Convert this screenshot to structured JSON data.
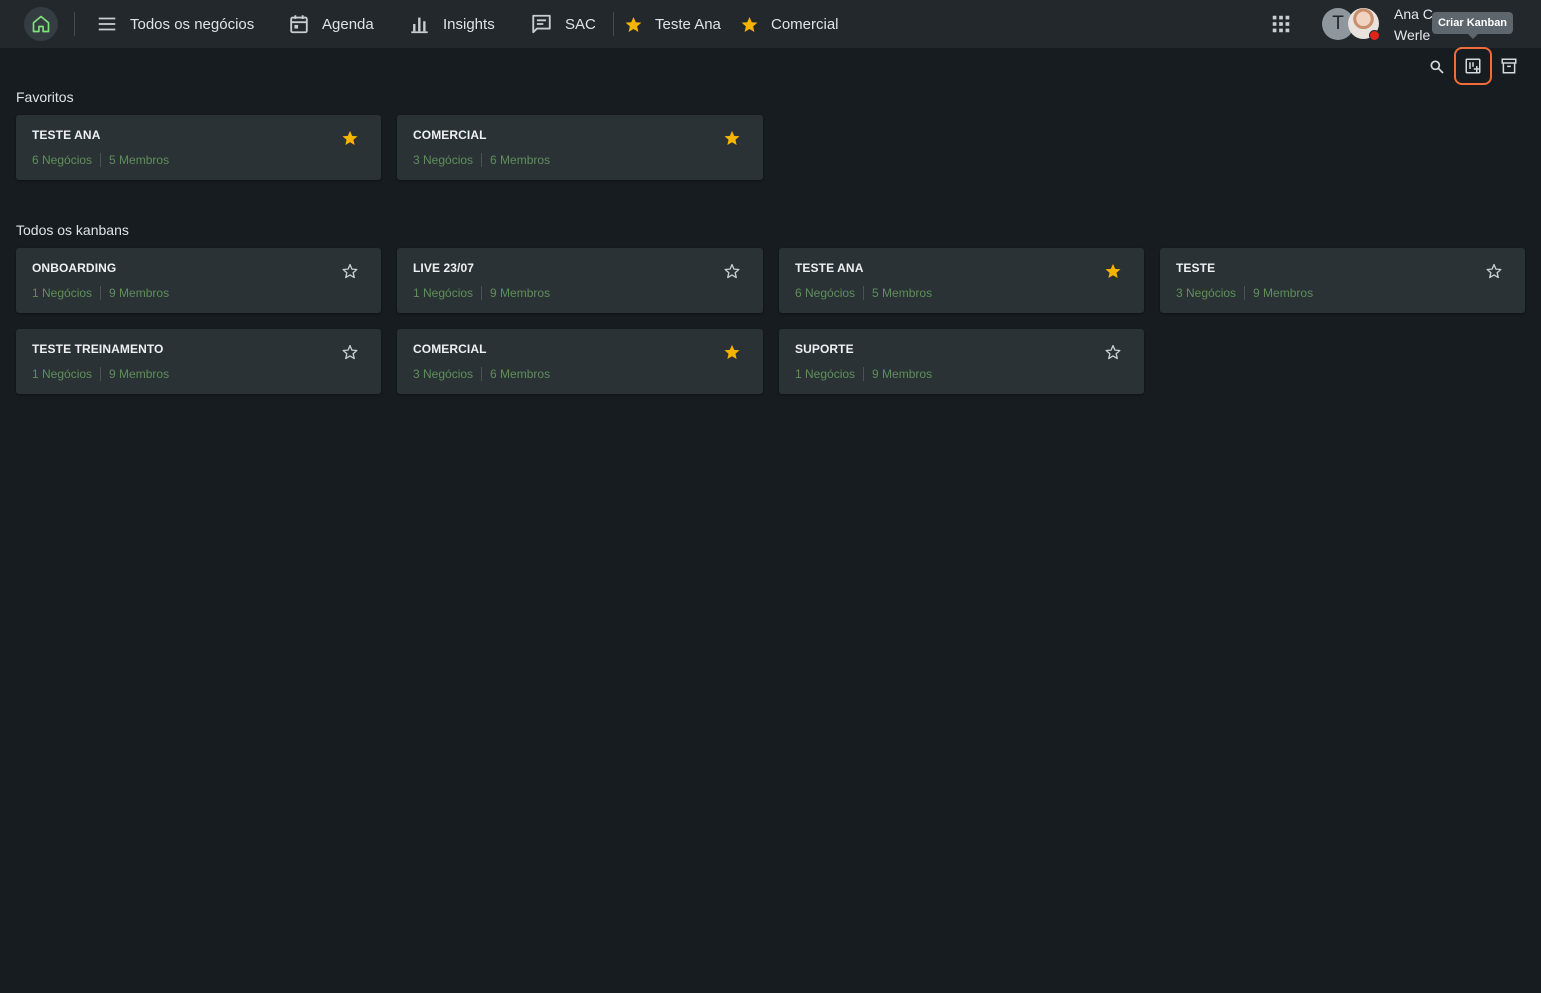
{
  "colors": {
    "accent": "#f26b3a",
    "star": "#f5b400",
    "meta_text": "#5e8f5a",
    "home_icon": "#7ee27a"
  },
  "nav": {
    "home_icon": "home-icon",
    "items": [
      {
        "label": "Todos os negócios",
        "icon": "menu-icon"
      },
      {
        "label": "Agenda",
        "icon": "calendar-icon"
      },
      {
        "label": "Insights",
        "icon": "bar-chart-icon"
      },
      {
        "label": "SAC",
        "icon": "chat-icon"
      },
      {
        "label": "Teste Ana",
        "icon": "star-icon"
      },
      {
        "label": "Comercial",
        "icon": "star-icon"
      }
    ]
  },
  "user": {
    "avatar_initial": "T",
    "name_line1": "Ana C",
    "name_line2": "Werle"
  },
  "tooltip": {
    "text": "Criar Kanban"
  },
  "sections": {
    "favorites_title": "Favoritos",
    "all_title": "Todos os kanbans"
  },
  "favorites": [
    {
      "title": "TESTE ANA",
      "deals": "6 Negócios",
      "members": "5 Membros",
      "starred": true
    },
    {
      "title": "COMERCIAL",
      "deals": "3 Negócios",
      "members": "6 Membros",
      "starred": true
    }
  ],
  "kanbans": [
    {
      "title": "ONBOARDING",
      "deals": "1 Negócios",
      "members": "9 Membros",
      "starred": false
    },
    {
      "title": "LIVE 23/07",
      "deals": "1 Negócios",
      "members": "9 Membros",
      "starred": false
    },
    {
      "title": "TESTE ANA",
      "deals": "6 Negócios",
      "members": "5 Membros",
      "starred": true
    },
    {
      "title": "TESTE",
      "deals": "3 Negócios",
      "members": "9 Membros",
      "starred": false
    },
    {
      "title": "TESTE TREINAMENTO",
      "deals": "1 Negócios",
      "members": "9 Membros",
      "starred": false
    },
    {
      "title": "COMERCIAL",
      "deals": "3 Negócios",
      "members": "6 Membros",
      "starred": true
    },
    {
      "title": "SUPORTE",
      "deals": "1 Negócios",
      "members": "9 Membros",
      "starred": false
    }
  ]
}
